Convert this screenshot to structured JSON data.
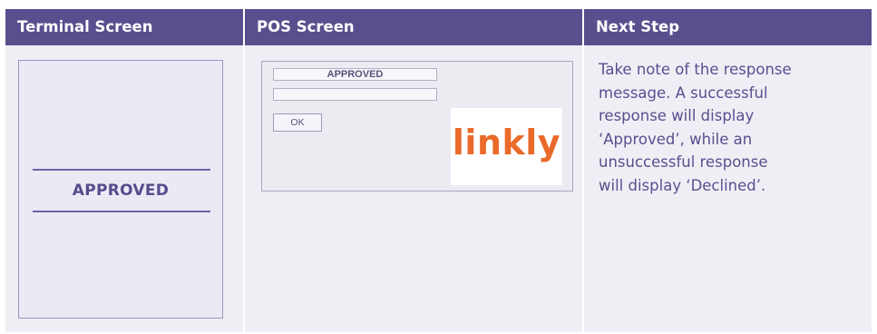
{
  "headers": {
    "terminal": "Terminal Screen",
    "pos": "POS Screen",
    "next": "Next Step"
  },
  "terminal_screen": {
    "message": "APPROVED"
  },
  "pos_screen": {
    "response_field": "APPROVED",
    "second_field": "",
    "ok_button": "OK",
    "logo_text": "linkly"
  },
  "next_step": {
    "lines": [
      "Take note of the response",
      "message. A successful",
      "response will display",
      "‘Approved’, while an",
      "unsuccessful response",
      "will display ‘Declined’."
    ]
  },
  "colors": {
    "header_bg": "#5b4e8e",
    "body_bg": "#f0eef5",
    "accent_text": "#5b4e8e",
    "logo": "#ea6a2a"
  }
}
